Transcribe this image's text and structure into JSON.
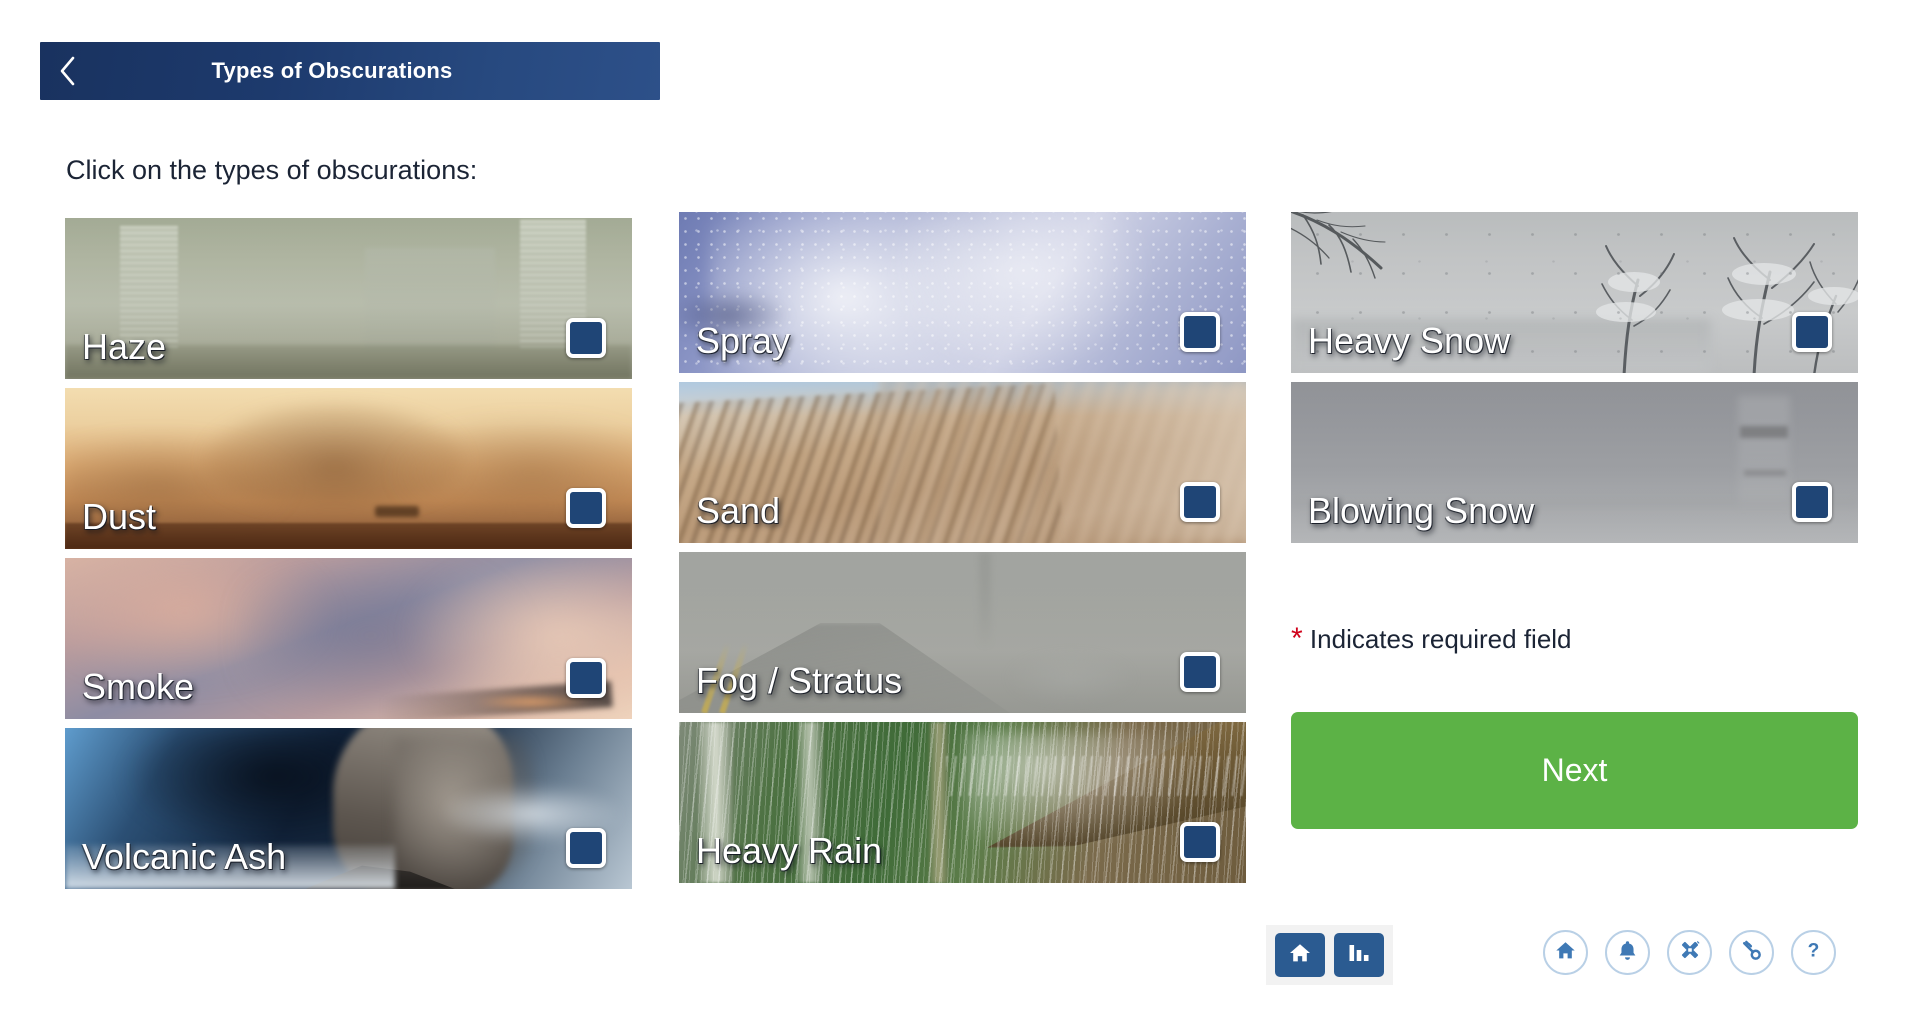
{
  "header": {
    "title": "Types of Obscurations",
    "back_icon": "chevron-left-icon"
  },
  "instruction": "Click on the types of obscurations:",
  "columns": [
    {
      "id": "column-1",
      "tiles": [
        {
          "label": "Haze",
          "checked": false,
          "art": "haze"
        },
        {
          "label": "Dust",
          "checked": false,
          "art": "dust"
        },
        {
          "label": "Smoke",
          "checked": false,
          "art": "smoke"
        },
        {
          "label": "Volcanic Ash",
          "checked": false,
          "art": "volcanic-ash"
        }
      ]
    },
    {
      "id": "column-2",
      "tiles": [
        {
          "label": "Spray",
          "checked": false,
          "art": "spray"
        },
        {
          "label": "Sand",
          "checked": false,
          "art": "sand"
        },
        {
          "label": "Fog / Stratus",
          "checked": false,
          "art": "fog"
        },
        {
          "label": "Heavy Rain",
          "checked": false,
          "art": "rain"
        }
      ]
    },
    {
      "id": "column-3",
      "tiles": [
        {
          "label": "Heavy Snow",
          "checked": false,
          "art": "heavy-snow"
        },
        {
          "label": "Blowing Snow",
          "checked": false,
          "art": "blowing-snow"
        }
      ]
    }
  ],
  "required_note": {
    "star": "*",
    "text": "Indicates required field"
  },
  "next_button": {
    "label": "Next"
  },
  "bottom_nav": {
    "items": [
      {
        "icon": "home-icon"
      },
      {
        "icon": "bar-chart-icon"
      }
    ]
  },
  "toolbar": {
    "items": [
      {
        "icon": "home-icon"
      },
      {
        "icon": "bell-icon"
      },
      {
        "icon": "satellite-icon"
      },
      {
        "icon": "key-icon"
      },
      {
        "icon": "question-mark-icon"
      }
    ]
  },
  "colors": {
    "header_dark": "#19325f",
    "header_light": "#2d5089",
    "checkbox_fill": "#1f4576",
    "next_green": "#5cb246",
    "required_red": "#d0021b",
    "nav_blue": "#2b5b91",
    "toolbar_blue": "#3f79b5",
    "text_dark": "#1b2435",
    "page_bg": "#ffffff"
  }
}
